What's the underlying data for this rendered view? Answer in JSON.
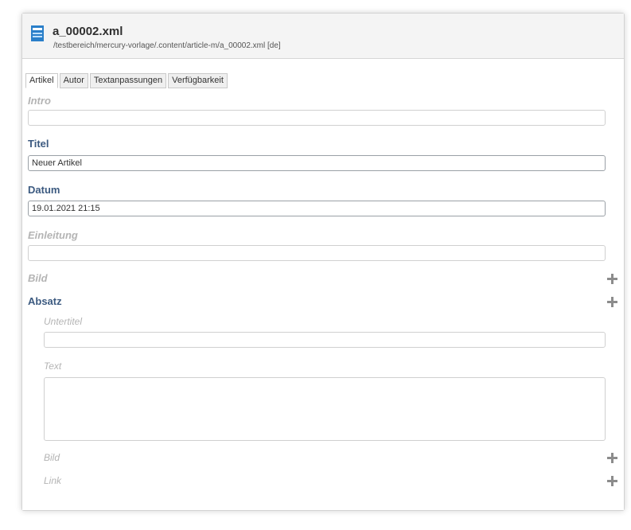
{
  "header": {
    "icon": "xml-file-icon",
    "title": "a_00002.xml",
    "path": "/testbereich/mercury-vorlage/.content/article-m/a_00002.xml [de]"
  },
  "tabs": [
    {
      "label": "Artikel",
      "active": true
    },
    {
      "label": "Autor",
      "active": false
    },
    {
      "label": "Textanpassungen",
      "active": false
    },
    {
      "label": "Verfügbarkeit",
      "active": false
    }
  ],
  "fields": {
    "intro": {
      "label": "Intro",
      "value": ""
    },
    "titel": {
      "label": "Titel",
      "value": "Neuer Artikel"
    },
    "datum": {
      "label": "Datum",
      "value": "19.01.2021 21:15"
    },
    "einleitung": {
      "label": "Einleitung",
      "value": ""
    },
    "bild": {
      "label": "Bild"
    },
    "absatz": {
      "label": "Absatz",
      "untertitel": {
        "label": "Untertitel",
        "value": ""
      },
      "text": {
        "label": "Text",
        "value": ""
      },
      "bild": {
        "label": "Bild"
      },
      "link": {
        "label": "Link"
      }
    }
  },
  "colors": {
    "label_active": "#3c5a80",
    "label_optional": "#b4b4b4",
    "icon_blue": "#2a7fc9"
  }
}
